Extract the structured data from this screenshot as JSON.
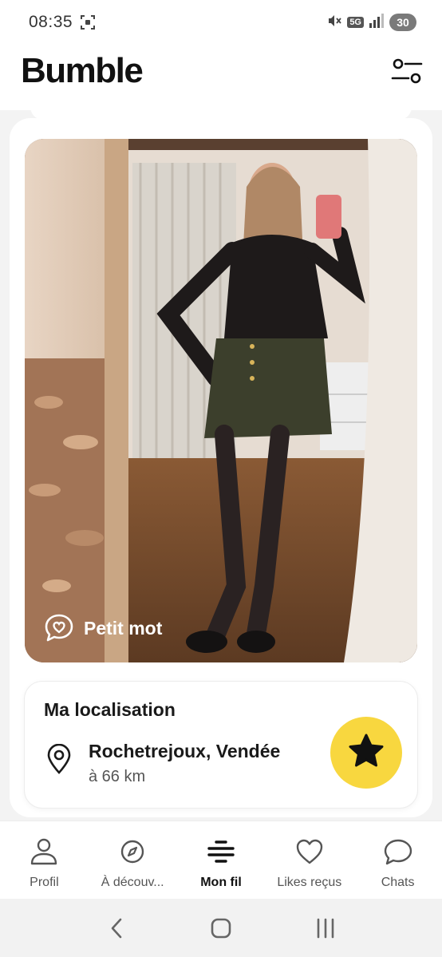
{
  "status_bar": {
    "time": "08:35",
    "network": "5G",
    "battery": "30"
  },
  "header": {
    "app_name": "Bumble",
    "filter_icon": "filter-sliders-icon"
  },
  "profile": {
    "photo_alt": "Photo de profil",
    "compliment_button": "Petit mot",
    "compliment_icon": "chat-heart-icon",
    "location": {
      "title": "Ma localisation",
      "city": "Rochetrejoux, Vendée",
      "distance": "à 66 km",
      "icon": "location-pin-icon"
    },
    "superswipe_icon": "star-icon"
  },
  "bottom_nav": {
    "items": [
      {
        "label": "Profil",
        "icon": "person-icon",
        "active": false
      },
      {
        "label": "À découv...",
        "icon": "compass-icon",
        "active": false
      },
      {
        "label": "Mon fil",
        "icon": "feed-icon",
        "active": true
      },
      {
        "label": "Likes reçus",
        "icon": "heart-icon",
        "active": false
      },
      {
        "label": "Chats",
        "icon": "chat-bubble-icon",
        "active": false
      }
    ]
  },
  "system_nav": {
    "back": "back-icon",
    "home": "home-icon",
    "recents": "recents-icon"
  },
  "colors": {
    "accent": "#f8d73f",
    "background": "#f3f3f3",
    "text": "#1a1a1a"
  }
}
